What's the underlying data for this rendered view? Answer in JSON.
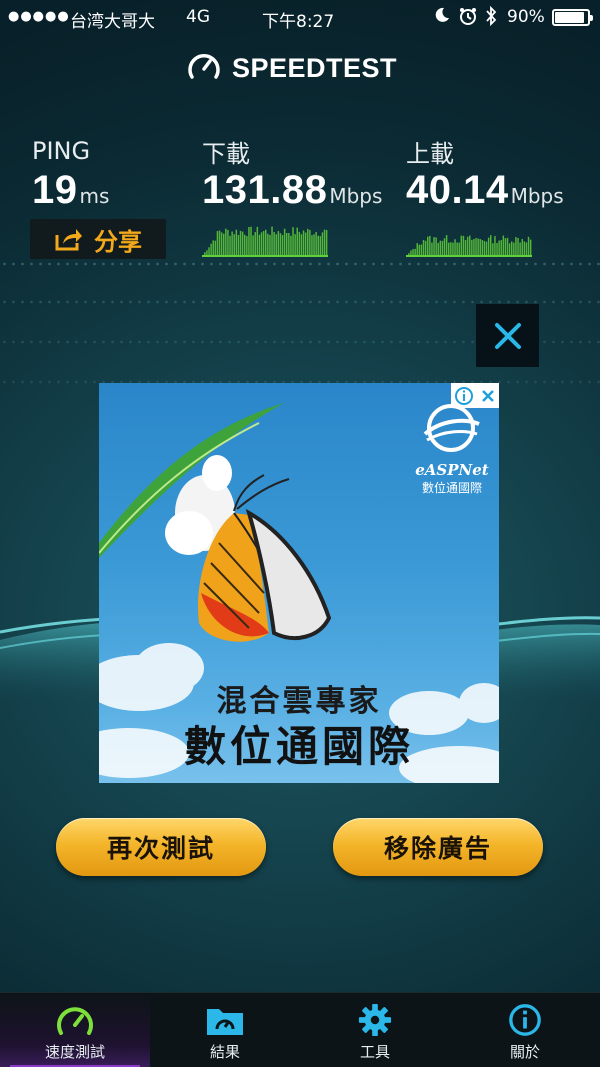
{
  "status_bar": {
    "signal": "●●●●●",
    "carrier": "台湾大哥大",
    "network": "4G",
    "time": "下午8:27",
    "battery": "90%",
    "battery_level": 0.9
  },
  "app": {
    "title": "SPEEDTEST"
  },
  "metrics": {
    "ping": {
      "label": "PING",
      "value": "19",
      "unit": "ms"
    },
    "download": {
      "label": "下載",
      "value": "131.88",
      "unit": "Mbps"
    },
    "upload": {
      "label": "上載",
      "value": "40.14",
      "unit": "Mbps"
    }
  },
  "share_label": "分享",
  "ad": {
    "logo_text": "eASPNet",
    "logo_subtext": "數位通國際",
    "headline": "混合雲專家",
    "brand": "數位通國際"
  },
  "buttons": {
    "retest": "再次測試",
    "remove_ads": "移除廣告"
  },
  "tabs": [
    {
      "label": "速度測試",
      "icon": "speedometer-icon",
      "active": true
    },
    {
      "label": "結果",
      "icon": "results-folder-icon",
      "active": false
    },
    {
      "label": "工具",
      "icon": "gear-icon",
      "active": false
    },
    {
      "label": "關於",
      "icon": "info-icon",
      "active": false
    }
  ],
  "colors": {
    "accent_gold": "#f2a91b",
    "graph_green": "#5fcf3a",
    "close_blue": "#2bb7e8",
    "active_tab": "#8a3cc8"
  }
}
